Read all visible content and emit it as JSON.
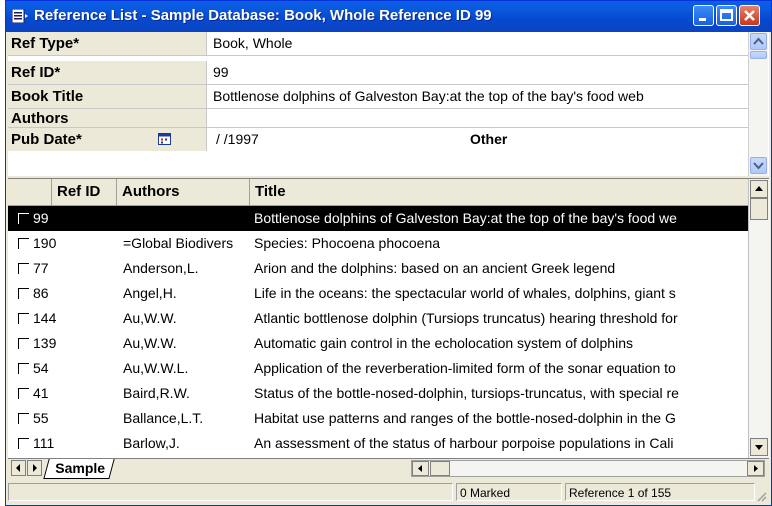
{
  "window": {
    "title": "Reference List - Sample Database: Book, Whole Reference ID 99",
    "controls": [
      "minimize",
      "maximize",
      "close"
    ]
  },
  "form": {
    "fields": [
      {
        "label": "Ref Type*",
        "value": "Book, Whole"
      },
      {
        "label": "Ref ID*",
        "value": "99"
      },
      {
        "label": "Book Title",
        "value": "Bottlenose dolphins of Galveston Bay:at the top of the bay's food web"
      },
      {
        "label": "Authors",
        "value": ""
      },
      {
        "label": "Pub Date*",
        "value": "/  /1997",
        "extra_label": "Other"
      }
    ]
  },
  "grid": {
    "columns": [
      "",
      "Ref ID",
      "Authors",
      "Title"
    ],
    "rows": [
      {
        "id": "99",
        "authors": "",
        "title": "Bottlenose dolphins of Galveston Bay:at the top of the bay's food we",
        "selected": true
      },
      {
        "id": "190",
        "authors": "=Global Biodivers",
        "title": "Species: Phocoena phocoena"
      },
      {
        "id": "77",
        "authors": "Anderson,L.",
        "title": "Arion and the dolphins: based on an ancient Greek legend"
      },
      {
        "id": "86",
        "authors": "Angel,H.",
        "title": "Life in the oceans: the spectacular world of whales, dolphins, giant s"
      },
      {
        "id": "144",
        "authors": "Au,W.W.",
        "title": "Atlantic bottlenose dolphin (Tursiops truncatus) hearing threshold for"
      },
      {
        "id": "139",
        "authors": "Au,W.W.",
        "title": "Automatic gain control in the echolocation system of dolphins"
      },
      {
        "id": "54",
        "authors": "Au,W.W.L.",
        "title": "Application of the reverberation-limited form of the sonar equation to"
      },
      {
        "id": "41",
        "authors": "Baird,R.W.",
        "title": "Status of the bottle-nosed-dolphin, tursiops-truncatus, with special re"
      },
      {
        "id": "55",
        "authors": "Ballance,L.T.",
        "title": "Habitat use patterns and ranges of the bottle-nosed-dolphin in the G"
      },
      {
        "id": "111",
        "authors": "Barlow,J.",
        "title": "An assessment of the status of harbour porpoise populations in Cali"
      }
    ]
  },
  "tabs": {
    "active": "Sample"
  },
  "status": {
    "marked": "0 Marked",
    "position": "Reference 1 of 155"
  },
  "colors": {
    "titlebar": "#0a5fe8",
    "selection": "#000000",
    "chrome": "#ece9d8"
  }
}
